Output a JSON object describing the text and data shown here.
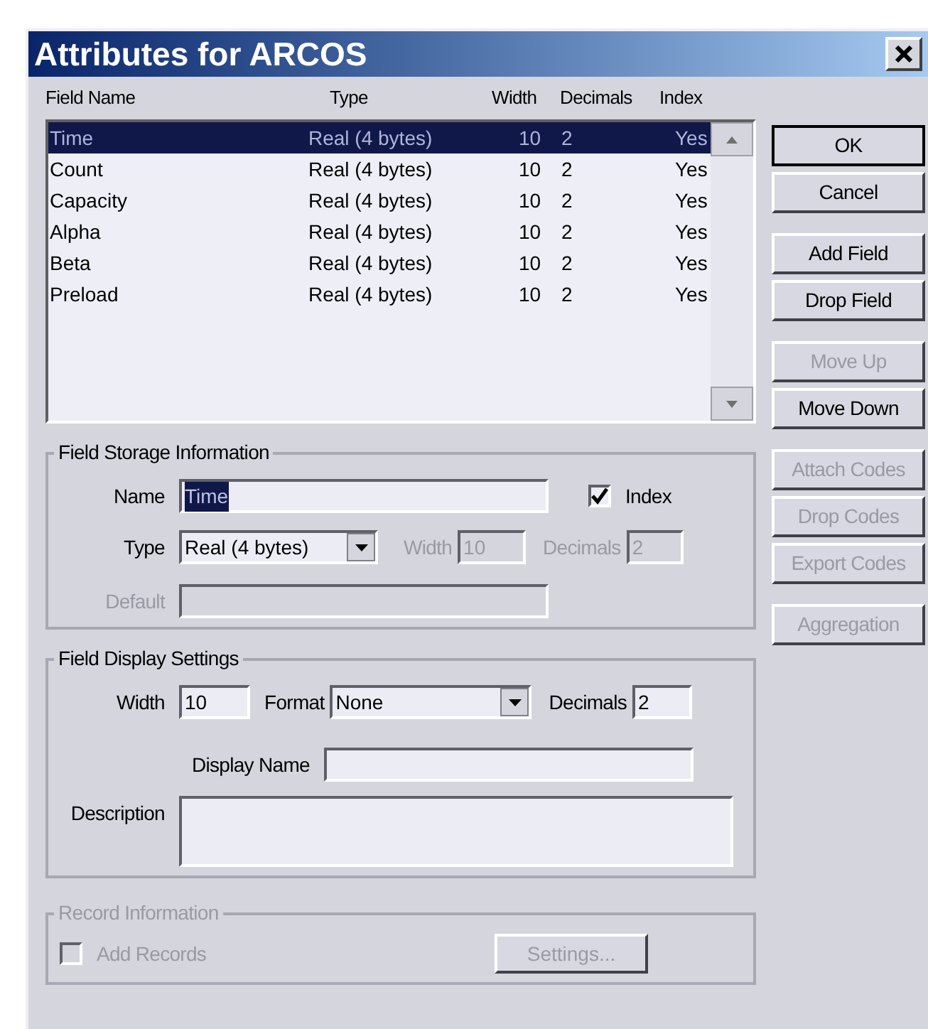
{
  "window": {
    "title": "Attributes for ARCOS"
  },
  "list": {
    "columns": [
      "Field Name",
      "Type",
      "Width",
      "Decimals",
      "Index"
    ],
    "rows": [
      {
        "cells": [
          "Time",
          "Real (4 bytes)",
          "10",
          "2",
          "Yes"
        ],
        "selected": true
      },
      {
        "cells": [
          "Count",
          "Real (4 bytes)",
          "10",
          "2",
          "Yes"
        ],
        "selected": false
      },
      {
        "cells": [
          "Capacity",
          "Real (4 bytes)",
          "10",
          "2",
          "Yes"
        ],
        "selected": false
      },
      {
        "cells": [
          "Alpha",
          "Real (4 bytes)",
          "10",
          "2",
          "Yes"
        ],
        "selected": false
      },
      {
        "cells": [
          "Beta",
          "Real (4 bytes)",
          "10",
          "2",
          "Yes"
        ],
        "selected": false
      },
      {
        "cells": [
          "Preload",
          "Real (4 bytes)",
          "10",
          "2",
          "Yes"
        ],
        "selected": false
      }
    ]
  },
  "button_groups": [
    [
      {
        "label": "OK",
        "disabled": false,
        "is_default": true
      },
      {
        "label": "Cancel",
        "disabled": false,
        "is_default": false
      }
    ],
    [
      {
        "label": "Add Field",
        "disabled": false,
        "is_default": false
      },
      {
        "label": "Drop Field",
        "disabled": false,
        "is_default": false
      }
    ],
    [
      {
        "label": "Move Up",
        "disabled": true,
        "is_default": false
      },
      {
        "label": "Move Down",
        "disabled": false,
        "is_default": false
      }
    ],
    [
      {
        "label": "Attach Codes",
        "disabled": true,
        "is_default": false
      },
      {
        "label": "Drop Codes",
        "disabled": true,
        "is_default": false
      },
      {
        "label": "Export Codes",
        "disabled": true,
        "is_default": false
      }
    ],
    [
      {
        "label": "Aggregation",
        "disabled": true,
        "is_default": false
      }
    ]
  ],
  "field_storage": {
    "title": "Field Storage Information",
    "name": {
      "label": "Name",
      "value": "Time",
      "text_selected": true
    },
    "index": {
      "label": "Index",
      "checked": true
    },
    "type": {
      "label": "Type",
      "value": "Real (4 bytes)"
    },
    "width": {
      "label": "Width",
      "value": "10",
      "disabled": true
    },
    "decimals": {
      "label": "Decimals",
      "value": "2",
      "disabled": true
    },
    "default": {
      "label": "Default",
      "disabled": true
    }
  },
  "field_display": {
    "title": "Field Display Settings",
    "width": {
      "label": "Width",
      "value": "10"
    },
    "format": {
      "label": "Format",
      "value": "None"
    },
    "decimals": {
      "label": "Decimals",
      "value": "2"
    },
    "display_name": {
      "label": "Display Name"
    },
    "description": {
      "label": "Description"
    }
  },
  "record_info": {
    "title": "Record Information",
    "disabled": true,
    "add_records": {
      "label": "Add Records",
      "checked": false
    },
    "settings": {
      "label": "Settings..."
    }
  }
}
